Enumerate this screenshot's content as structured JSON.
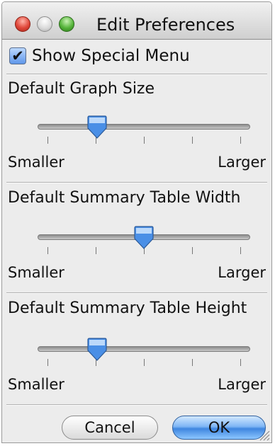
{
  "window": {
    "title": "Edit Preferences"
  },
  "checkbox": {
    "label": "Show Special Menu",
    "checked": true
  },
  "sliders": [
    {
      "title": "Default Graph Size",
      "min_label": "Smaller",
      "max_label": "Larger",
      "value": 0.28,
      "ticks": 5
    },
    {
      "title": "Default Summary Table Width",
      "min_label": "Smaller",
      "max_label": "Larger",
      "value": 0.5,
      "ticks": 5
    },
    {
      "title": "Default Summary Table Height",
      "min_label": "Smaller",
      "max_label": "Larger",
      "value": 0.28,
      "ticks": 5
    }
  ],
  "buttons": {
    "cancel_label": "Cancel",
    "ok_label": "OK"
  },
  "colors": {
    "accent": "#4a8fe6",
    "window_bg": "#ececec"
  }
}
